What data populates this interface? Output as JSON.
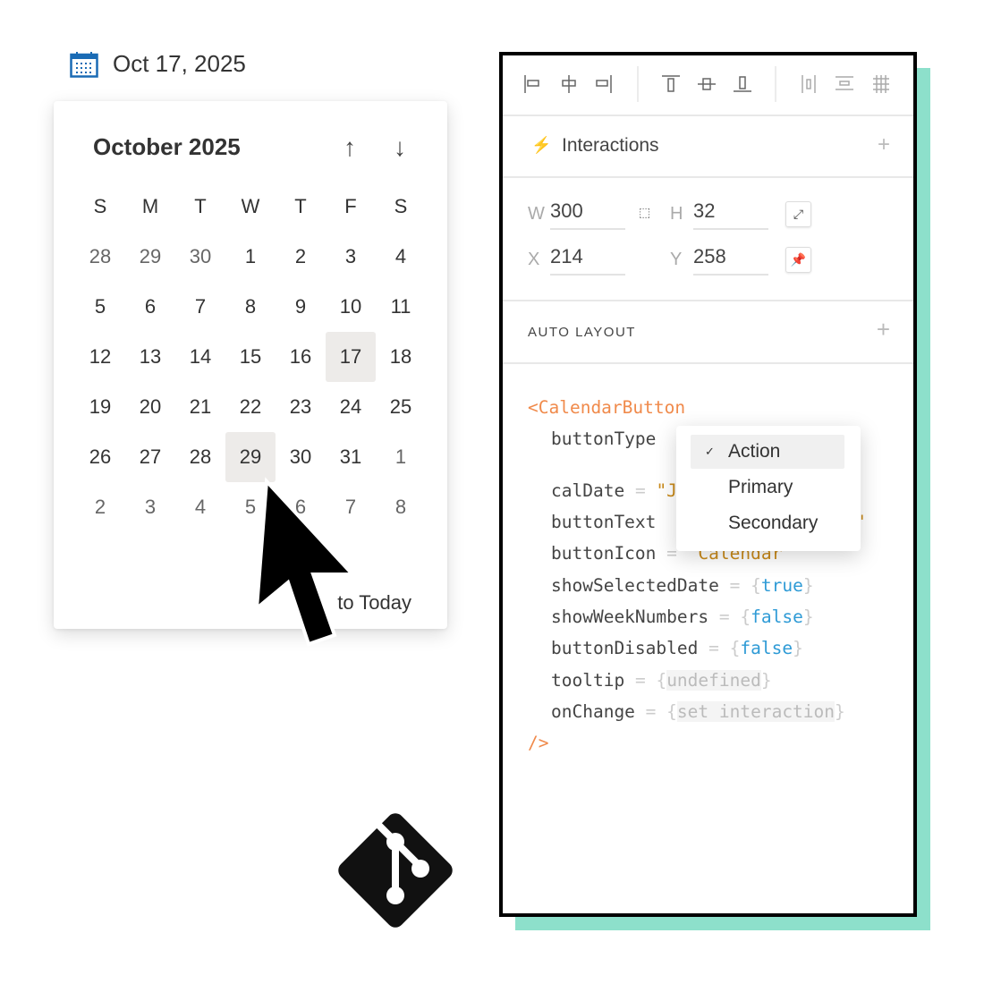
{
  "date_display": {
    "text": "Oct 17, 2025",
    "icon": "calendar-icon",
    "icon_color": "#1a6bb5"
  },
  "calendar": {
    "month": "October 2025",
    "weekdays": [
      "S",
      "M",
      "T",
      "W",
      "T",
      "F",
      "S"
    ],
    "days": [
      [
        "28",
        "29",
        "30",
        "1",
        "2",
        "3",
        "4"
      ],
      [
        "5",
        "6",
        "7",
        "8",
        "9",
        "10",
        "11"
      ],
      [
        "12",
        "13",
        "14",
        "15",
        "16",
        "17",
        "18"
      ],
      [
        "19",
        "20",
        "21",
        "22",
        "23",
        "24",
        "25"
      ],
      [
        "26",
        "27",
        "28",
        "29",
        "30",
        "31",
        "1"
      ],
      [
        "2",
        "3",
        "4",
        "5",
        "6",
        "7",
        "8"
      ]
    ],
    "selected": "17",
    "hovered": "29",
    "go_today": "to Today"
  },
  "panel": {
    "interactions": "Interactions",
    "w_label": "W",
    "w": "300",
    "h_label": "H",
    "h": "32",
    "x_label": "X",
    "x": "214",
    "y_label": "Y",
    "y": "258",
    "auto_layout": "AUTO LAYOUT",
    "accent": "#8de0cb",
    "code": {
      "open": "<CalendarButton",
      "close": "/>",
      "eq": "=",
      "buttonType": "buttonType",
      "calDate": "calDate",
      "calDate_val": "\"J",
      "buttonText": "buttonText",
      "buttonText_val": "\"",
      "buttonIcon": "buttonIcon",
      "buttonIcon_val": "\"Calendar\"",
      "showSelectedDate": "showSelectedDate",
      "showSelectedDate_val": "true",
      "showWeekNumbers": "showWeekNumbers",
      "showWeekNumbers_val": "false",
      "buttonDisabled": "buttonDisabled",
      "buttonDisabled_val": "false",
      "tooltip": "tooltip",
      "tooltip_val": "undefined",
      "onChange": "onChange",
      "onChange_val": "set interaction"
    },
    "dropdown": {
      "options": [
        "Action",
        "Primary",
        "Secondary"
      ],
      "selected": "Action",
      "check": "✓"
    }
  }
}
